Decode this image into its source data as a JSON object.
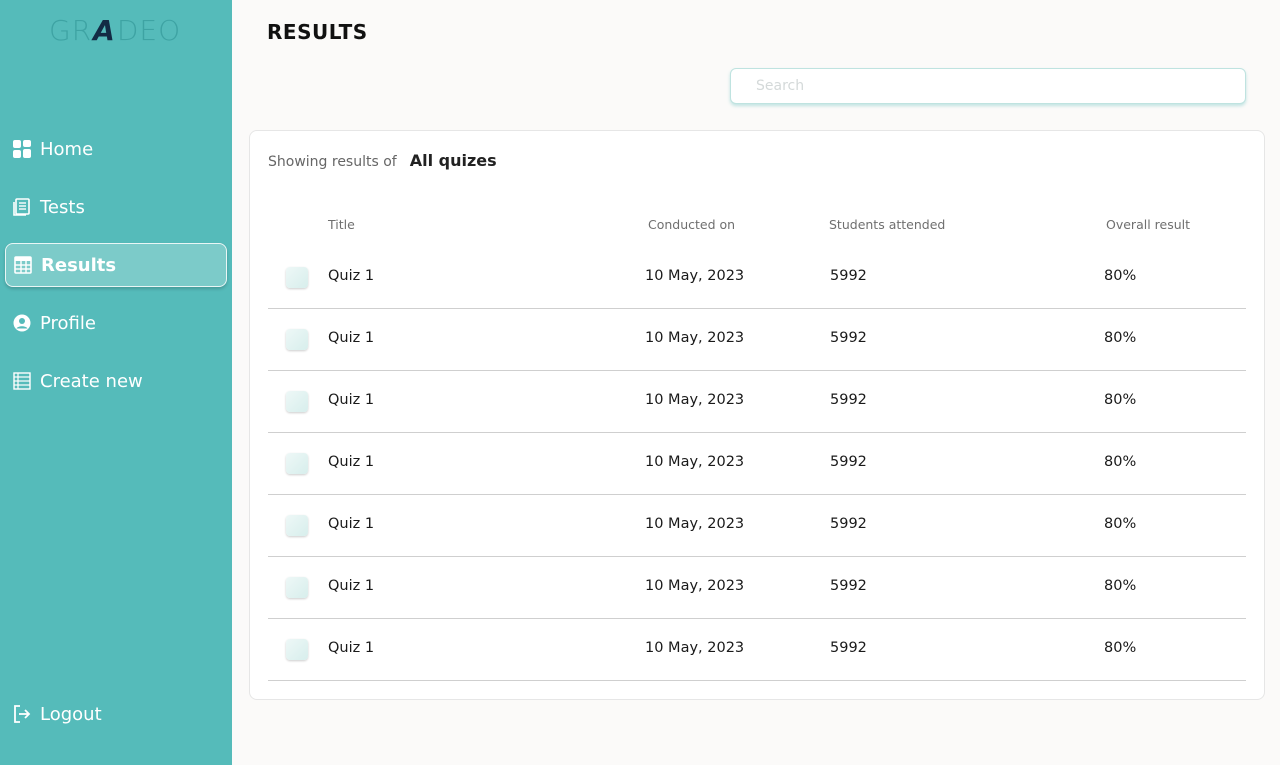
{
  "app": {
    "logo": {
      "left": "GR",
      "mid": "A",
      "right": "DEO"
    }
  },
  "sidebar": {
    "items": [
      {
        "label": "Home",
        "icon": "grid-icon",
        "active": false
      },
      {
        "label": "Tests",
        "icon": "document-list-icon",
        "active": false
      },
      {
        "label": "Results",
        "icon": "table-icon",
        "active": true
      },
      {
        "label": "Profile",
        "icon": "user-circle-icon",
        "active": false
      },
      {
        "label": "Create new",
        "icon": "list-add-icon",
        "active": false
      }
    ],
    "logout": {
      "label": "Logout",
      "icon": "logout-icon"
    }
  },
  "header": {
    "title": "RESULTS"
  },
  "search": {
    "placeholder": "Search",
    "value": ""
  },
  "results": {
    "showing_label": "Showing results of",
    "filter_value": "All quizes",
    "columns": {
      "title": "Title",
      "conducted_on": "Conducted on",
      "students_attended": "Students attended",
      "overall_result": "Overall result"
    },
    "rows": [
      {
        "title": "Quiz 1",
        "conducted_on": "10 May, 2023",
        "students_attended": "5992",
        "overall_result": "80%"
      },
      {
        "title": "Quiz 1",
        "conducted_on": "10 May, 2023",
        "students_attended": "5992",
        "overall_result": "80%"
      },
      {
        "title": "Quiz 1",
        "conducted_on": "10 May, 2023",
        "students_attended": "5992",
        "overall_result": "80%"
      },
      {
        "title": "Quiz 1",
        "conducted_on": "10 May, 2023",
        "students_attended": "5992",
        "overall_result": "80%"
      },
      {
        "title": "Quiz 1",
        "conducted_on": "10 May, 2023",
        "students_attended": "5992",
        "overall_result": "80%"
      },
      {
        "title": "Quiz 1",
        "conducted_on": "10 May, 2023",
        "students_attended": "5992",
        "overall_result": "80%"
      },
      {
        "title": "Quiz 1",
        "conducted_on": "10 May, 2023",
        "students_attended": "5992",
        "overall_result": "80%"
      }
    ]
  },
  "colors": {
    "sidebar": "#55bbba",
    "active_item": "#7ccbc9",
    "background": "#fbfaf9",
    "logo_accent": "#132b44"
  }
}
